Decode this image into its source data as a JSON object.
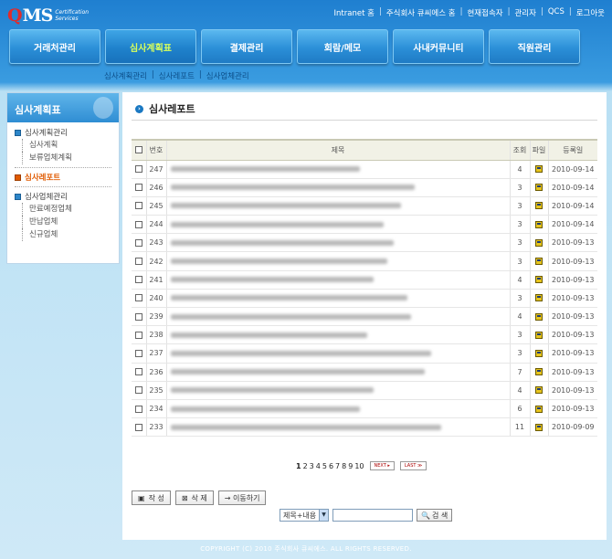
{
  "brand": {
    "logo_q": "Q",
    "logo_ms": "MS",
    "logo_sub_1": "Certification",
    "logo_sub_2": "Services"
  },
  "topnav": [
    "Intranet 홈",
    "주식회사 큐씨에스 홈",
    "현재접속자",
    "관리자",
    "QCS",
    "로그아웃"
  ],
  "mainnav": [
    "거래처관리",
    "심사계획표",
    "결제관리",
    "회람/메모",
    "사내커뮤니티",
    "직원관리"
  ],
  "subnav": [
    "심사계획관리",
    "심사레포트",
    "심사업체관리"
  ],
  "sidebar": {
    "title": "심사계획표",
    "groups": [
      {
        "label": "심사계획관리",
        "items": [
          "심사계획",
          "보류업체계획"
        ]
      },
      {
        "label": "심사레포트",
        "items": []
      },
      {
        "label": "심사업체관리",
        "items": [
          "만료예정업체",
          "반납업체",
          "신규업체"
        ]
      }
    ]
  },
  "main": {
    "title": "심사레포트",
    "columns": {
      "no": "번호",
      "title": "제목",
      "views": "조회",
      "file": "파일",
      "date": "등록일"
    },
    "rows": [
      {
        "no": "247",
        "views": "4",
        "date": "2010-09-14",
        "w": 0.56
      },
      {
        "no": "246",
        "views": "3",
        "date": "2010-09-14",
        "w": 0.72
      },
      {
        "no": "245",
        "views": "3",
        "date": "2010-09-14",
        "w": 0.68
      },
      {
        "no": "244",
        "views": "3",
        "date": "2010-09-14",
        "w": 0.63
      },
      {
        "no": "243",
        "views": "3",
        "date": "2010-09-13",
        "w": 0.66
      },
      {
        "no": "242",
        "views": "3",
        "date": "2010-09-13",
        "w": 0.64
      },
      {
        "no": "241",
        "views": "4",
        "date": "2010-09-13",
        "w": 0.6
      },
      {
        "no": "240",
        "views": "3",
        "date": "2010-09-13",
        "w": 0.7
      },
      {
        "no": "239",
        "views": "4",
        "date": "2010-09-13",
        "w": 0.71
      },
      {
        "no": "238",
        "views": "3",
        "date": "2010-09-13",
        "w": 0.58
      },
      {
        "no": "237",
        "views": "3",
        "date": "2010-09-13",
        "w": 0.77
      },
      {
        "no": "236",
        "views": "7",
        "date": "2010-09-13",
        "w": 0.75
      },
      {
        "no": "235",
        "views": "4",
        "date": "2010-09-13",
        "w": 0.6
      },
      {
        "no": "234",
        "views": "6",
        "date": "2010-09-13",
        "w": 0.56
      },
      {
        "no": "233",
        "views": "11",
        "date": "2010-09-09",
        "w": 0.8
      }
    ],
    "pagination": {
      "pages": [
        "1",
        "2",
        "3",
        "4",
        "5",
        "6",
        "7",
        "8",
        "9",
        "10"
      ],
      "next": "NEXT ▸",
      "last": "LAST ≫"
    },
    "actions": {
      "write": "작 성",
      "delete": "삭 제",
      "move": "→ 이동하기"
    },
    "search": {
      "select": "제목+내용",
      "button": "검 색"
    }
  },
  "footer": "COPYRIGHT (C) 2010 주식회사 큐씨에스. ALL RIGHTS RESERVED."
}
